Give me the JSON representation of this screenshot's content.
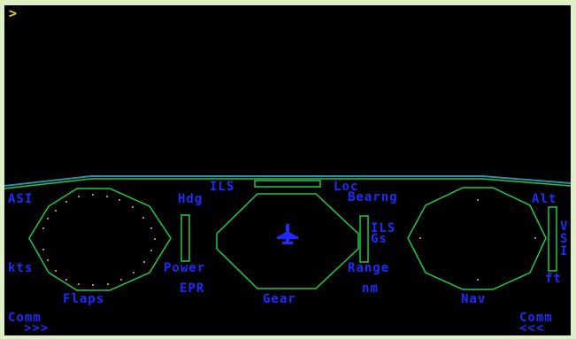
{
  "prompt": ">",
  "instruments": {
    "asi": "ASI",
    "kts": "kts",
    "flaps": "Flaps",
    "hdg": "Hdg",
    "power": "Power",
    "epr": "EPR",
    "ils_top": "ILS",
    "loc": "Loc",
    "bearng": "Bearng",
    "gear": "Gear",
    "ils_side": "ILS",
    "gs": "Gs",
    "range": "Range",
    "nm": "nm",
    "alt": "Alt",
    "vsi": "VSI",
    "ft": "ft",
    "nav": "Nav"
  },
  "comm_left": {
    "label": "Comm",
    "arrows": ">>>"
  },
  "comm_right": {
    "label": "Comm",
    "arrows": "<<<"
  },
  "colors": {
    "background": "#000000",
    "border": "#dff0c6",
    "instrument_lines": "#22c84a",
    "labels": "#1c2cff",
    "prompt": "#f2d21a",
    "dial_dots": "#e6c83c",
    "horizon": "#2a8fa8"
  },
  "icons": {
    "aircraft": "airplane-icon"
  }
}
